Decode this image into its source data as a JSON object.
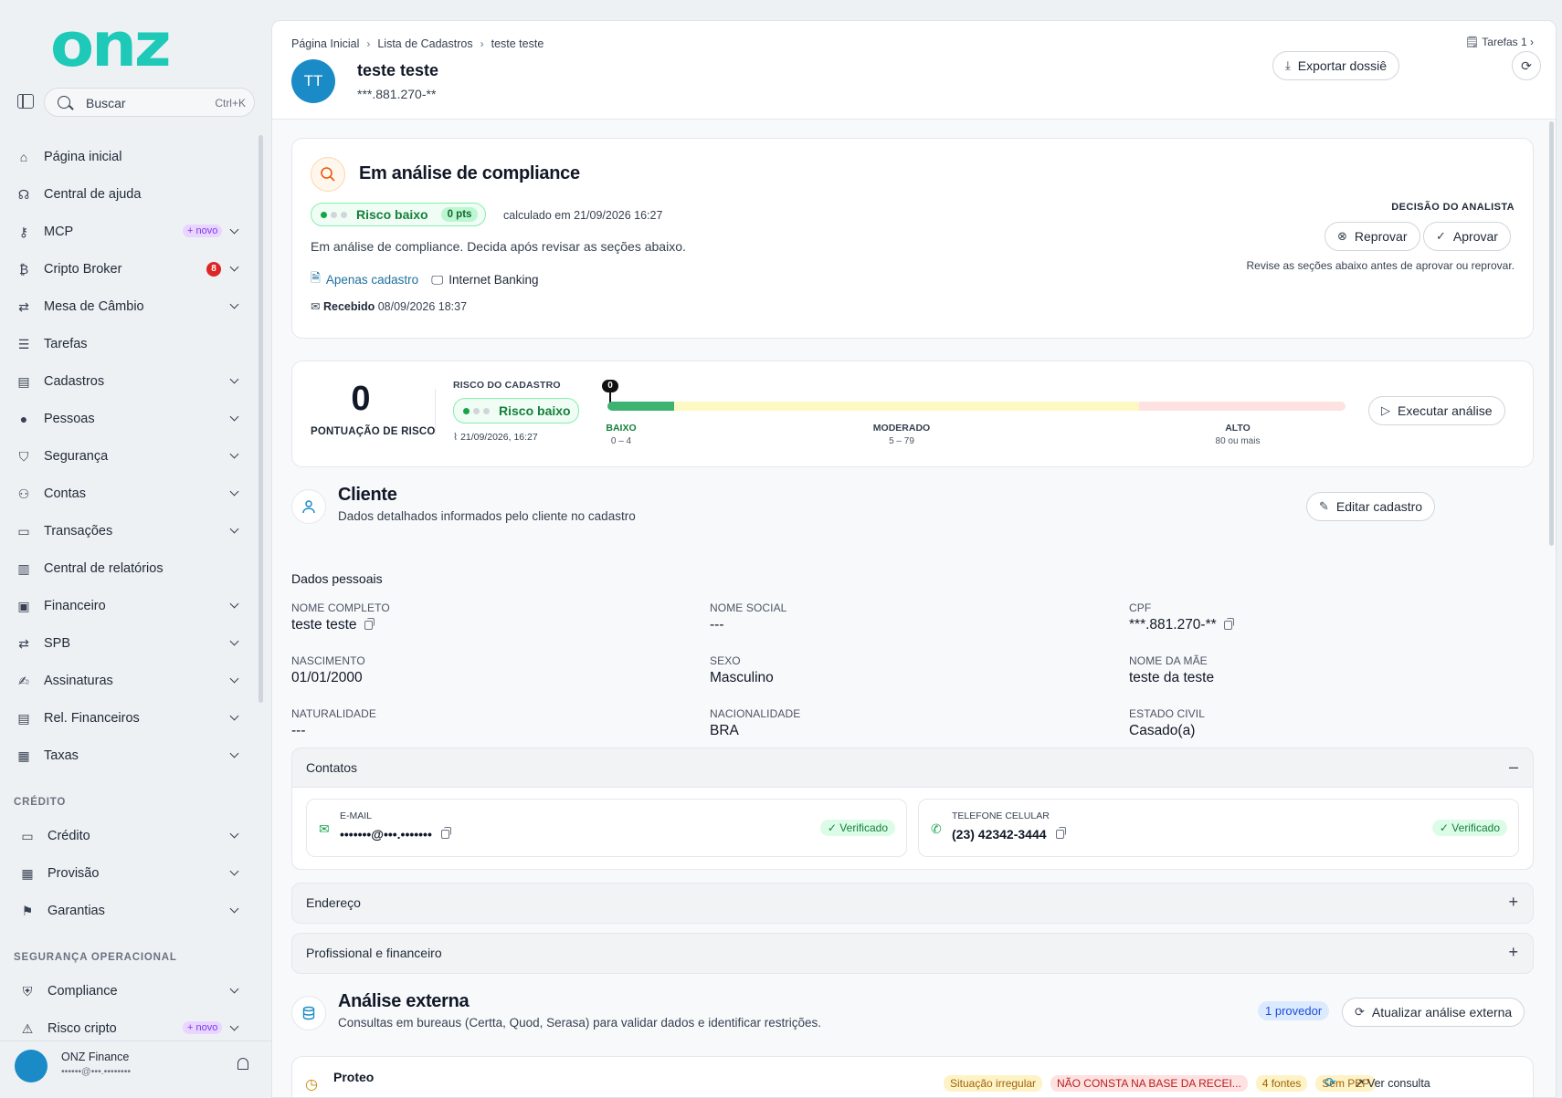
{
  "brand": "onz",
  "search": {
    "placeholder": "Buscar",
    "shortcut": "Ctrl+K"
  },
  "nav": [
    {
      "label": "Página inicial",
      "icon": "home-icon"
    },
    {
      "label": "Central de ajuda",
      "icon": "headset-icon"
    },
    {
      "label": "MCP",
      "icon": "key-icon",
      "badge": "+ novo"
    },
    {
      "label": "Cripto Broker",
      "icon": "bitcoin-icon",
      "count": "8"
    },
    {
      "label": "Mesa de Câmbio",
      "icon": "exchange-icon"
    },
    {
      "label": "Tarefas",
      "icon": "tasks-icon"
    },
    {
      "label": "Cadastros",
      "icon": "clipboard-icon"
    },
    {
      "label": "Pessoas",
      "icon": "person-icon"
    },
    {
      "label": "Segurança",
      "icon": "shield-check-icon"
    },
    {
      "label": "Contas",
      "icon": "users-icon"
    },
    {
      "label": "Transações",
      "icon": "card-icon"
    },
    {
      "label": "Central de relatórios",
      "icon": "report-icon"
    },
    {
      "label": "Financeiro",
      "icon": "monitor-icon"
    },
    {
      "label": "SPB",
      "icon": "exchange-icon"
    },
    {
      "label": "Assinaturas",
      "icon": "signature-icon"
    },
    {
      "label": "Rel. Financeiros",
      "icon": "clipboard-icon"
    },
    {
      "label": "Taxas",
      "icon": "money-icon"
    }
  ],
  "credit_section": {
    "title": "CRÉDITO",
    "items": [
      {
        "label": "Crédito",
        "icon": "card-icon"
      },
      {
        "label": "Provisão",
        "icon": "money-icon"
      },
      {
        "label": "Garantias",
        "icon": "guarantee-icon"
      }
    ]
  },
  "ops_section": {
    "title": "SEGURANÇA OPERACIONAL",
    "items": [
      {
        "label": "Compliance",
        "icon": "shield-icon"
      },
      {
        "label": "Risco cripto",
        "icon": "alert-icon",
        "badge": "+ novo"
      }
    ]
  },
  "user": {
    "name": "ONZ Finance",
    "email": "••••••@•••.••••••••"
  },
  "breadcrumb": [
    "Página Inicial",
    "Lista de Cadastros",
    "teste teste"
  ],
  "tasks_label": "Tarefas 1",
  "header": {
    "initials": "TT",
    "name": "teste teste",
    "doc": "***.881.270-**",
    "export_label": "Exportar dossiê"
  },
  "compliance": {
    "title": "Em análise de compliance",
    "risk_label": "Risco baixo",
    "points": "0 pts",
    "calculated": "calculado em 21/09/2026 16:27",
    "description": "Em análise de compliance. Decida após revisar as seções abaixo.",
    "tag1": "Apenas cadastro",
    "tag2": "Internet Banking",
    "received_label": "Recebido",
    "received_date": "08/09/2026 18:37",
    "decision_title": "DECISÃO DO ANALISTA",
    "reject_label": "Reprovar",
    "approve_label": "Aprovar",
    "decision_hint": "Revise as seções abaixo antes de aprovar ou reprovar."
  },
  "risk": {
    "score": "0",
    "score_label": "PONTUAÇÃO DE RISCO",
    "title": "RISCO DO CADASTRO",
    "label": "Risco baixo",
    "date": "21/09/2026, 16:27",
    "marker": "0",
    "zones": [
      {
        "name": "BAIXO",
        "range": "0 – 4"
      },
      {
        "name": "MODERADO",
        "range": "5 – 79"
      },
      {
        "name": "ALTO",
        "range": "80 ou mais"
      }
    ],
    "run_label": "Executar análise"
  },
  "client": {
    "title": "Cliente",
    "subtitle": "Dados detalhados informados pelo cliente no cadastro",
    "edit_label": "Editar cadastro",
    "personal_title": "Dados pessoais",
    "fields": [
      {
        "label": "NOME COMPLETO",
        "value": "teste teste",
        "copy": true
      },
      {
        "label": "NOME SOCIAL",
        "value": "---"
      },
      {
        "label": "CPF",
        "value": "***.881.270-**",
        "copy": true
      },
      {
        "label": "NASCIMENTO",
        "value": "01/01/2000"
      },
      {
        "label": "SEXO",
        "value": "Masculino"
      },
      {
        "label": "NOME DA MÃE",
        "value": "teste da teste"
      },
      {
        "label": "NATURALIDADE",
        "value": "---"
      },
      {
        "label": "NACIONALIDADE",
        "value": "BRA"
      },
      {
        "label": "ESTADO CIVIL",
        "value": "Casado(a)"
      }
    ]
  },
  "contacts": {
    "title": "Contatos",
    "email_label": "E-MAIL",
    "email_value": "•••••••@•••.•••••••",
    "phone_label": "TELEFONE CELULAR",
    "phone_value": "(23) 42342-3444",
    "verified": "Verificado"
  },
  "address_title": "Endereço",
  "professional_title": "Profissional e financeiro",
  "external": {
    "title": "Análise externa",
    "subtitle": "Consultas em bureaus (Certta, Quod, Serasa) para validar dados e identificar restrições.",
    "providers": "1 provedor",
    "refresh_label": "Atualizar análise externa",
    "provider_name": "Proteo",
    "chips": [
      "Situação irregular",
      "NÃO CONSTA NA BASE DA RECEI...",
      "4 fontes",
      "Sem PEP"
    ],
    "view_label": "Ver consulta"
  },
  "colors": {
    "brand": "#1ec9b8",
    "accent": "#1a8bc7",
    "success": "#16a34a",
    "danger": "#dc2626"
  }
}
